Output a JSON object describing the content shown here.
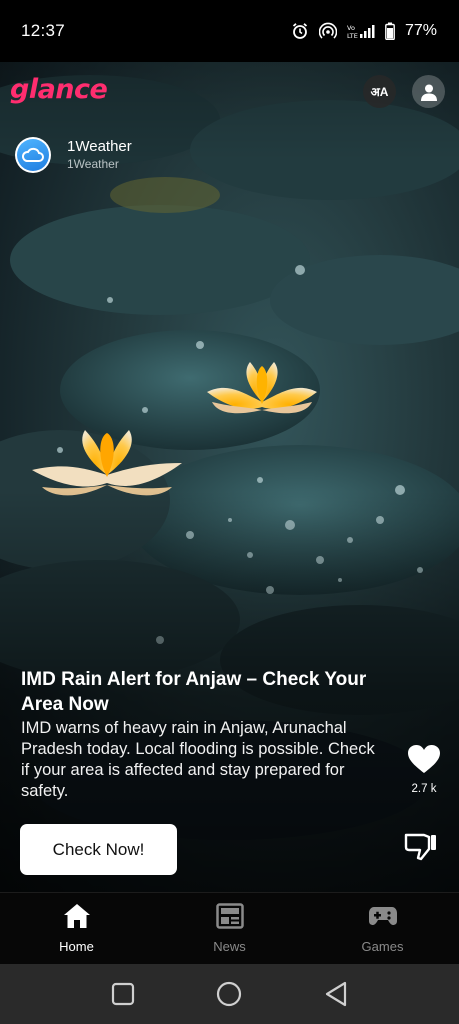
{
  "status_bar": {
    "time": "12:37",
    "battery": "77%",
    "icons": [
      "alarm-icon",
      "hotspot-icon",
      "lte-signal-icon",
      "battery-icon"
    ]
  },
  "header": {
    "logo": "glance",
    "logo_color": "#ff2d6f",
    "language_button": "अA",
    "profile_icon": "profile-icon"
  },
  "source": {
    "name": "1Weather",
    "subtitle": "1Weather",
    "icon": "cloud-icon"
  },
  "article": {
    "headline": "IMD Rain Alert for Anjaw – Check Your Area Now",
    "description": "IMD warns of heavy rain in Anjaw, Arunachal Pradesh today. Local flooding is possible. Check if your area is affected and stay prepared for safety.",
    "cta_label": "Check Now!",
    "likes": "2.7 k"
  },
  "bottom_nav": {
    "items": [
      {
        "label": "Home",
        "icon": "home-icon",
        "active": true
      },
      {
        "label": "News",
        "icon": "news-icon",
        "active": false
      },
      {
        "label": "Games",
        "icon": "gamepad-icon",
        "active": false
      }
    ]
  },
  "system_nav": [
    "recents-icon",
    "home-circle-icon",
    "back-icon"
  ]
}
